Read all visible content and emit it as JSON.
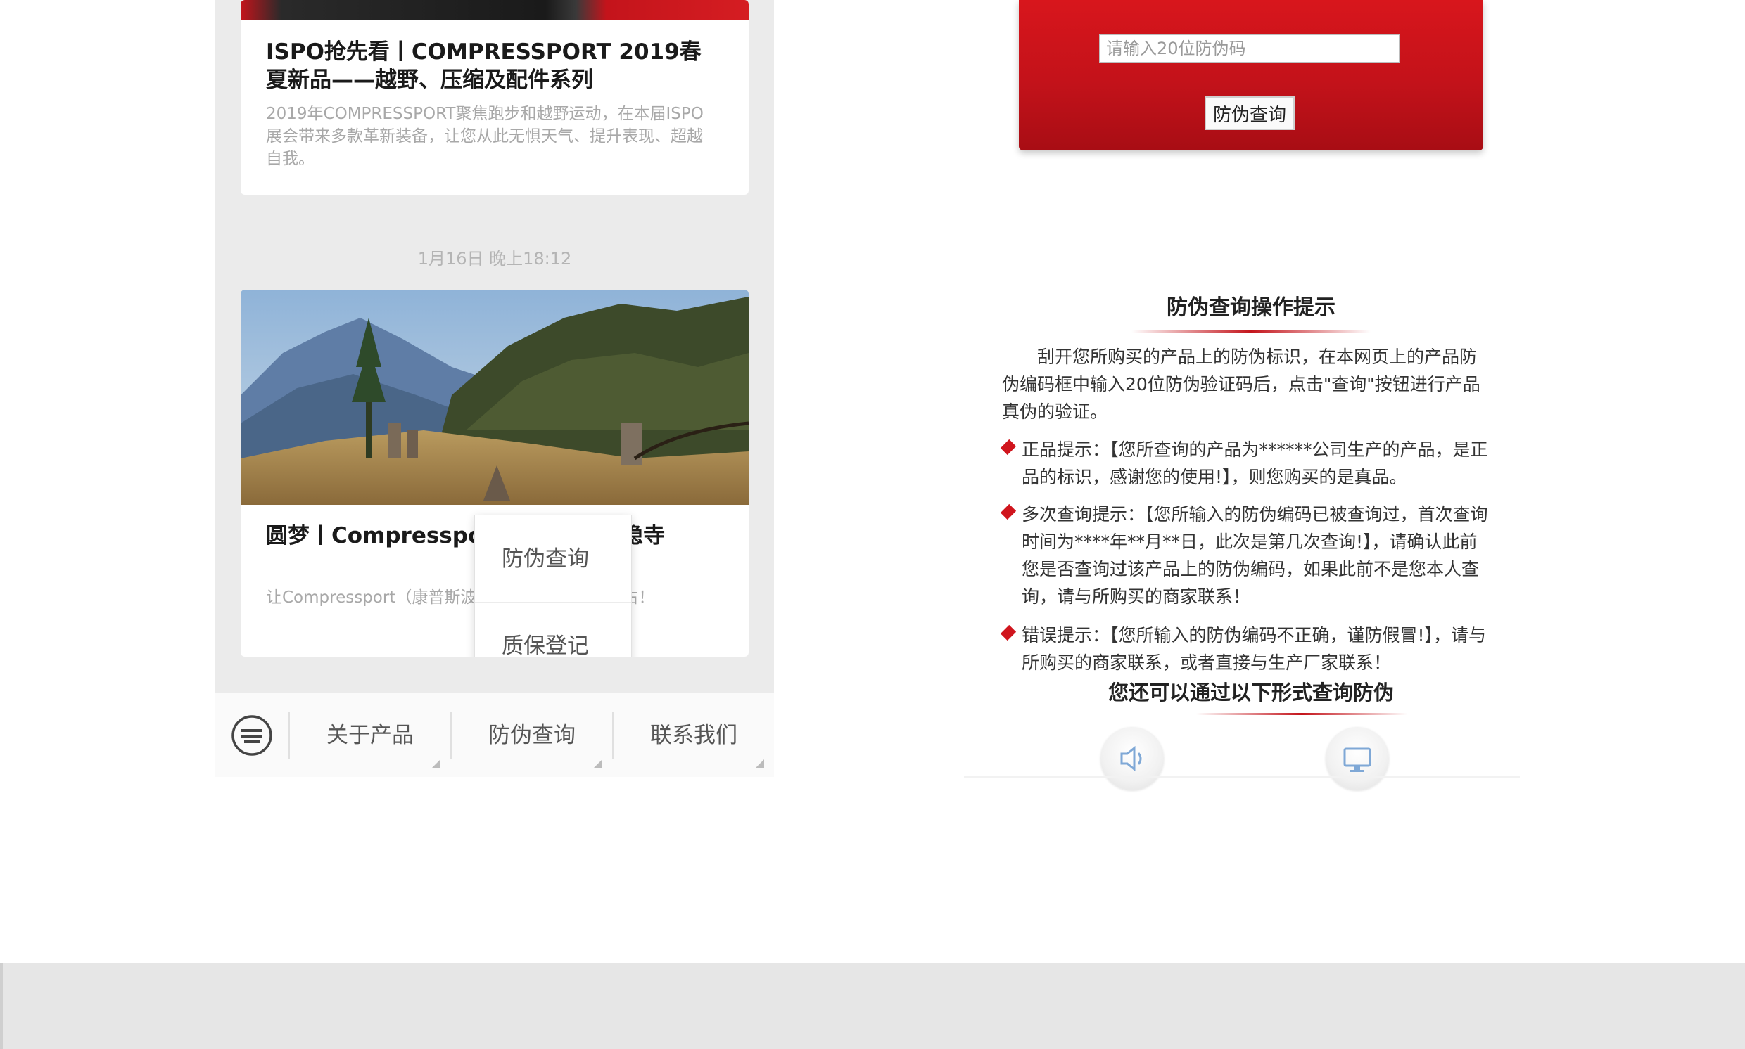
{
  "left_phone": {
    "articles": [
      {
        "title": "ISPO抢先看丨COMPRESSPORT 2019春夏新品——越野、压缩及配件系列",
        "desc": "2019年COMPRESSPORT聚焦跑步和越野运动，在本届ISPO展会带来多款革新装备，让您从此无惧天气、提升表现、超越自我。"
      },
      {
        "title": "圆梦丨Compressport——寻隐·栖隐寺",
        "desc": "让Compressport（康普斯波特）时刻陪伴在你左右！"
      }
    ],
    "timestamp": "1月16日 晚上18:12",
    "popup": {
      "items": [
        "防伪查询",
        "质保登记"
      ]
    },
    "menu": {
      "keyboard_icon": "keyboard-icon",
      "items": [
        "关于产品",
        "防伪查询",
        "联系我们"
      ]
    }
  },
  "right_phone": {
    "verify": {
      "placeholder": "请输入20位防伪码",
      "button": "防伪查询"
    },
    "tips": {
      "title": "防伪查询操作提示",
      "intro": "刮开您所购买的产品上的防伪标识，在本网页上的产品防伪编码框中输入20位防伪验证码后，点击\"查询\"按钮进行产品真伪的验证。",
      "items": [
        "正品提示：【您所查询的产品为******公司生产的产品，是正品的标识，感谢您的使用!】，则您购买的是真品。",
        "多次查询提示：【您所输入的防伪编码已被查询过，首次查询时间为****年**月**日，此次是第几次查询!】，请确认此前您是否查询过该产品上的防伪编码，如果此前不是您本人查询，请与所购买的商家联系！",
        "错误提示：【您所输入的防伪编码不正确，谨防假冒!】，请与所购买的商家联系，或者直接与生产厂家联系！"
      ],
      "alt_title": "您还可以通过以下形式查询防伪"
    },
    "icons": [
      "speaker-icon",
      "monitor-icon"
    ],
    "colors": {
      "accent": "#c4141b"
    }
  }
}
